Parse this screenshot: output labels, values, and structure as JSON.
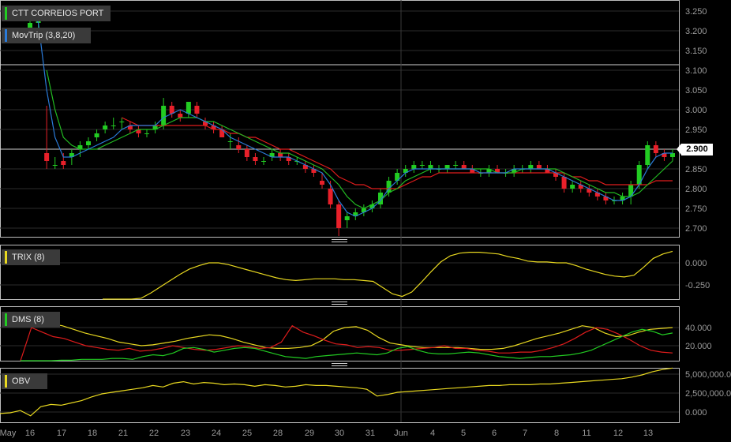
{
  "colors": {
    "up": "#22cc22",
    "down": "#e8202a",
    "mov_fast": "#2a7ad8",
    "mov_mid": "#22bb22",
    "mov_slow": "#e01c1c",
    "trix": "#e8d820",
    "obv": "#e8d820",
    "dms_plus": "#22cc22",
    "dms_minus": "#e01c1c",
    "adx": "#e8d820"
  },
  "legends": {
    "main_symbol": "CTT CORREIOS PORT",
    "main_indicator": "MovTrip (3,8,20)",
    "trix": "TRIX (8)",
    "dms": "DMS (8)",
    "obv": "OBV"
  },
  "current_price_label": "2.900",
  "chart_data": {
    "type": "candlestick",
    "x_labels": [
      "May",
      "16",
      "17",
      "18",
      "21",
      "22",
      "23",
      "24",
      "25",
      "28",
      "29",
      "30",
      "31",
      "Jun",
      "4",
      "5",
      "6",
      "7",
      "8",
      "11",
      "12",
      "13"
    ],
    "price_axis": {
      "ticks": [
        "3.250",
        "3.200",
        "3.150",
        "3.100",
        "3.050",
        "3.000",
        "2.950",
        "2.900",
        "2.850",
        "2.800",
        "2.750",
        "2.700"
      ],
      "ylim": [
        2.68,
        3.27
      ]
    },
    "trix_axis": {
      "ticks": [
        "0.000",
        "-0.250"
      ]
    },
    "dms_axis": {
      "ticks": [
        "40.000",
        "20.000"
      ]
    },
    "obv_axis": {
      "ticks": [
        "5,000,000.0",
        "2,500,000.0",
        "0.000"
      ]
    },
    "candles": [
      [
        3.2,
        3.25,
        3.19,
        3.22
      ],
      [
        3.22,
        3.24,
        3.2,
        3.23
      ],
      [
        2.89,
        3.01,
        2.85,
        2.87
      ],
      [
        2.86,
        2.88,
        2.85,
        2.86
      ],
      [
        2.87,
        2.89,
        2.85,
        2.86
      ],
      [
        2.88,
        2.9,
        2.86,
        2.89
      ],
      [
        2.9,
        2.92,
        2.88,
        2.91
      ],
      [
        2.91,
        2.93,
        2.9,
        2.92
      ],
      [
        2.93,
        2.95,
        2.92,
        2.94
      ],
      [
        2.95,
        2.97,
        2.94,
        2.96
      ],
      [
        2.96,
        2.98,
        2.95,
        2.96
      ],
      [
        2.97,
        2.98,
        2.95,
        2.97
      ],
      [
        2.96,
        2.97,
        2.94,
        2.95
      ],
      [
        2.95,
        2.96,
        2.93,
        2.94
      ],
      [
        2.94,
        2.95,
        2.93,
        2.94
      ],
      [
        2.95,
        2.97,
        2.94,
        2.96
      ],
      [
        2.96,
        3.03,
        2.95,
        3.01
      ],
      [
        3.01,
        3.02,
        2.98,
        2.99
      ],
      [
        2.99,
        3.0,
        2.97,
        2.98
      ],
      [
        2.99,
        3.02,
        2.98,
        3.02
      ],
      [
        3.01,
        3.02,
        2.98,
        2.99
      ],
      [
        2.97,
        2.98,
        2.95,
        2.96
      ],
      [
        2.96,
        2.97,
        2.94,
        2.95
      ],
      [
        2.95,
        2.96,
        2.93,
        2.93
      ],
      [
        2.92,
        2.94,
        2.9,
        2.92
      ],
      [
        2.91,
        2.93,
        2.89,
        2.9
      ],
      [
        2.9,
        2.91,
        2.87,
        2.88
      ],
      [
        2.88,
        2.89,
        2.86,
        2.87
      ],
      [
        2.87,
        2.88,
        2.86,
        2.87
      ],
      [
        2.88,
        2.9,
        2.87,
        2.89
      ],
      [
        2.89,
        2.9,
        2.87,
        2.88
      ],
      [
        2.88,
        2.89,
        2.86,
        2.87
      ],
      [
        2.87,
        2.88,
        2.86,
        2.87
      ],
      [
        2.86,
        2.87,
        2.84,
        2.85
      ],
      [
        2.85,
        2.86,
        2.83,
        2.84
      ],
      [
        2.82,
        2.84,
        2.8,
        2.81
      ],
      [
        2.8,
        2.82,
        2.75,
        2.76
      ],
      [
        2.76,
        2.77,
        2.68,
        2.7
      ],
      [
        2.72,
        2.74,
        2.7,
        2.73
      ],
      [
        2.73,
        2.75,
        2.72,
        2.74
      ],
      [
        2.74,
        2.76,
        2.73,
        2.75
      ],
      [
        2.75,
        2.77,
        2.74,
        2.76
      ],
      [
        2.76,
        2.8,
        2.75,
        2.79
      ],
      [
        2.79,
        2.83,
        2.78,
        2.82
      ],
      [
        2.82,
        2.85,
        2.81,
        2.84
      ],
      [
        2.84,
        2.86,
        2.83,
        2.85
      ],
      [
        2.85,
        2.87,
        2.84,
        2.86
      ],
      [
        2.86,
        2.87,
        2.85,
        2.86
      ],
      [
        2.85,
        2.87,
        2.84,
        2.86
      ],
      [
        2.85,
        2.86,
        2.84,
        2.85
      ],
      [
        2.85,
        2.86,
        2.84,
        2.86
      ],
      [
        2.86,
        2.87,
        2.85,
        2.86
      ],
      [
        2.86,
        2.87,
        2.85,
        2.85
      ],
      [
        2.85,
        2.86,
        2.84,
        2.84
      ],
      [
        2.84,
        2.85,
        2.83,
        2.84
      ],
      [
        2.84,
        2.86,
        2.83,
        2.85
      ],
      [
        2.85,
        2.86,
        2.84,
        2.84
      ],
      [
        2.84,
        2.85,
        2.83,
        2.84
      ],
      [
        2.84,
        2.86,
        2.83,
        2.85
      ],
      [
        2.85,
        2.86,
        2.84,
        2.85
      ],
      [
        2.85,
        2.87,
        2.84,
        2.86
      ],
      [
        2.86,
        2.87,
        2.85,
        2.85
      ],
      [
        2.85,
        2.86,
        2.84,
        2.84
      ],
      [
        2.84,
        2.85,
        2.82,
        2.83
      ],
      [
        2.83,
        2.84,
        2.79,
        2.8
      ],
      [
        2.8,
        2.82,
        2.79,
        2.81
      ],
      [
        2.81,
        2.82,
        2.79,
        2.8
      ],
      [
        2.8,
        2.81,
        2.78,
        2.79
      ],
      [
        2.79,
        2.8,
        2.77,
        2.78
      ],
      [
        2.78,
        2.79,
        2.76,
        2.77
      ],
      [
        2.77,
        2.78,
        2.76,
        2.77
      ],
      [
        2.77,
        2.79,
        2.76,
        2.78
      ],
      [
        2.78,
        2.82,
        2.76,
        2.81
      ],
      [
        2.81,
        2.87,
        2.8,
        2.86
      ],
      [
        2.86,
        2.92,
        2.85,
        2.91
      ],
      [
        2.91,
        2.92,
        2.88,
        2.89
      ],
      [
        2.89,
        2.9,
        2.87,
        2.88
      ],
      [
        2.88,
        2.9,
        2.87,
        2.89
      ]
    ],
    "mov_fast": [
      3.25,
      3.22,
      3.05,
      2.93,
      2.88,
      2.88,
      2.89,
      2.9,
      2.91,
      2.92,
      2.93,
      2.95,
      2.96,
      2.96,
      2.96,
      2.96,
      2.98,
      2.99,
      3.0,
      2.99,
      2.98,
      2.97,
      2.96,
      2.95,
      2.93,
      2.92,
      2.91,
      2.9,
      2.89,
      2.88,
      2.88,
      2.88,
      2.87,
      2.86,
      2.85,
      2.84,
      2.81,
      2.77,
      2.74,
      2.73,
      2.74,
      2.75,
      2.77,
      2.8,
      2.82,
      2.84,
      2.85,
      2.85,
      2.85,
      2.85,
      2.85,
      2.85,
      2.85,
      2.85,
      2.84,
      2.84,
      2.84,
      2.84,
      2.85,
      2.85,
      2.85,
      2.85,
      2.85,
      2.84,
      2.83,
      2.82,
      2.81,
      2.8,
      2.79,
      2.78,
      2.77,
      2.77,
      2.78,
      2.81,
      2.85,
      2.88,
      2.89,
      2.89
    ],
    "mov_mid": [
      null,
      null,
      3.1,
      3.0,
      2.93,
      2.91,
      2.9,
      2.9,
      2.9,
      2.91,
      2.92,
      2.93,
      2.94,
      2.95,
      2.95,
      2.95,
      2.96,
      2.97,
      2.98,
      2.98,
      2.98,
      2.97,
      2.97,
      2.96,
      2.95,
      2.94,
      2.93,
      2.92,
      2.91,
      2.9,
      2.89,
      2.89,
      2.88,
      2.87,
      2.86,
      2.85,
      2.83,
      2.81,
      2.78,
      2.76,
      2.75,
      2.76,
      2.77,
      2.79,
      2.8,
      2.82,
      2.83,
      2.84,
      2.85,
      2.85,
      2.85,
      2.85,
      2.85,
      2.85,
      2.85,
      2.85,
      2.84,
      2.84,
      2.84,
      2.85,
      2.85,
      2.85,
      2.85,
      2.85,
      2.84,
      2.83,
      2.82,
      2.81,
      2.8,
      2.79,
      2.79,
      2.78,
      2.78,
      2.79,
      2.81,
      2.83,
      2.85,
      2.87
    ],
    "mov_slow": [
      null,
      null,
      null,
      null,
      null,
      null,
      null,
      null,
      null,
      null,
      null,
      2.98,
      2.97,
      2.96,
      2.96,
      2.96,
      2.96,
      2.96,
      2.96,
      2.96,
      2.96,
      2.96,
      2.95,
      2.95,
      2.94,
      2.94,
      2.93,
      2.93,
      2.92,
      2.91,
      2.9,
      2.9,
      2.89,
      2.88,
      2.87,
      2.86,
      2.85,
      2.83,
      2.82,
      2.81,
      2.81,
      2.8,
      2.8,
      2.8,
      2.8,
      2.81,
      2.82,
      2.83,
      2.83,
      2.84,
      2.84,
      2.84,
      2.84,
      2.84,
      2.84,
      2.84,
      2.84,
      2.84,
      2.84,
      2.84,
      2.84,
      2.84,
      2.84,
      2.84,
      2.84,
      2.83,
      2.83,
      2.82,
      2.82,
      2.81,
      2.81,
      2.81,
      2.81,
      2.81,
      2.81,
      2.82,
      2.82,
      2.82
    ],
    "trix": [
      -0.58,
      -0.55,
      -0.5,
      -0.45,
      -0.4,
      -0.34,
      -0.27,
      -0.2,
      -0.13,
      -0.07,
      -0.03,
      0.0,
      0.0,
      -0.02,
      -0.05,
      -0.08,
      -0.11,
      -0.14,
      -0.17,
      -0.19,
      -0.2,
      -0.19,
      -0.18,
      -0.18,
      -0.18,
      -0.19,
      -0.19,
      -0.2,
      -0.21,
      -0.28,
      -0.35,
      -0.38,
      -0.33,
      -0.22,
      -0.1,
      0.01,
      0.08,
      0.11,
      0.12,
      0.12,
      0.11,
      0.1,
      0.07,
      0.05,
      0.02,
      0.01,
      0.01,
      0.0,
      0.0,
      -0.03,
      -0.07,
      -0.1,
      -0.13,
      -0.15,
      -0.16,
      -0.14,
      -0.05,
      0.05,
      0.1,
      0.13
    ],
    "dms_plus": [
      3,
      3,
      3,
      3,
      4,
      4,
      5,
      5,
      5,
      6,
      6,
      5,
      8,
      10,
      9,
      12,
      17,
      18,
      16,
      13,
      15,
      17,
      18,
      17,
      14,
      11,
      8,
      7,
      6,
      8,
      9,
      10,
      11,
      12,
      11,
      10,
      12,
      17,
      19,
      15,
      12,
      11,
      11,
      12,
      13,
      12,
      10,
      8,
      7,
      6,
      7,
      8,
      8,
      9,
      10,
      12,
      15,
      20,
      25,
      30,
      35,
      38,
      36,
      32,
      34
    ],
    "dms_minus": [
      2,
      40,
      35,
      30,
      28,
      24,
      20,
      18,
      16,
      15,
      17,
      14,
      15,
      17,
      20,
      18,
      16,
      15,
      16,
      18,
      20,
      19,
      17,
      18,
      24,
      42,
      35,
      31,
      26,
      22,
      21,
      18,
      19,
      18,
      15,
      15,
      16,
      17,
      18,
      20,
      17,
      17,
      15,
      14,
      12,
      12,
      13,
      13,
      15,
      18,
      22,
      28,
      35,
      40,
      38,
      33,
      27,
      20,
      15,
      13,
      12
    ],
    "adx": [
      46,
      48,
      44,
      42,
      38,
      34,
      31,
      28,
      24,
      22,
      20,
      21,
      23,
      25,
      28,
      30,
      32,
      31,
      28,
      24,
      21,
      18,
      17,
      17,
      18,
      20,
      26,
      36,
      40,
      41,
      37,
      29,
      23,
      21,
      19,
      18,
      18,
      18,
      18,
      17,
      16,
      16,
      17,
      20,
      24,
      28,
      31,
      34,
      38,
      42,
      40,
      34,
      30,
      31,
      35,
      38,
      39,
      40
    ],
    "obv": [
      -200000,
      -100000,
      200000,
      -500000,
      700000,
      1000000,
      900000,
      1200000,
      1500000,
      2000000,
      2400000,
      2600000,
      2800000,
      3000000,
      3200000,
      3500000,
      3300000,
      3800000,
      4000000,
      3700000,
      3900000,
      3800000,
      3600000,
      3700000,
      3600000,
      3400000,
      3600000,
      3500000,
      3300000,
      3400000,
      3600000,
      3500000,
      3500000,
      3400000,
      3300000,
      3200000,
      3000000,
      2100000,
      2300000,
      2600000,
      2700000,
      2800000,
      2900000,
      3000000,
      3100000,
      3200000,
      3300000,
      3400000,
      3500000,
      3500000,
      3600000,
      3600000,
      3600000,
      3700000,
      3700000,
      3800000,
      3900000,
      4000000,
      4100000,
      4200000,
      4300000,
      4400000,
      4600000,
      4900000,
      5300000,
      5600000,
      5800000
    ]
  }
}
